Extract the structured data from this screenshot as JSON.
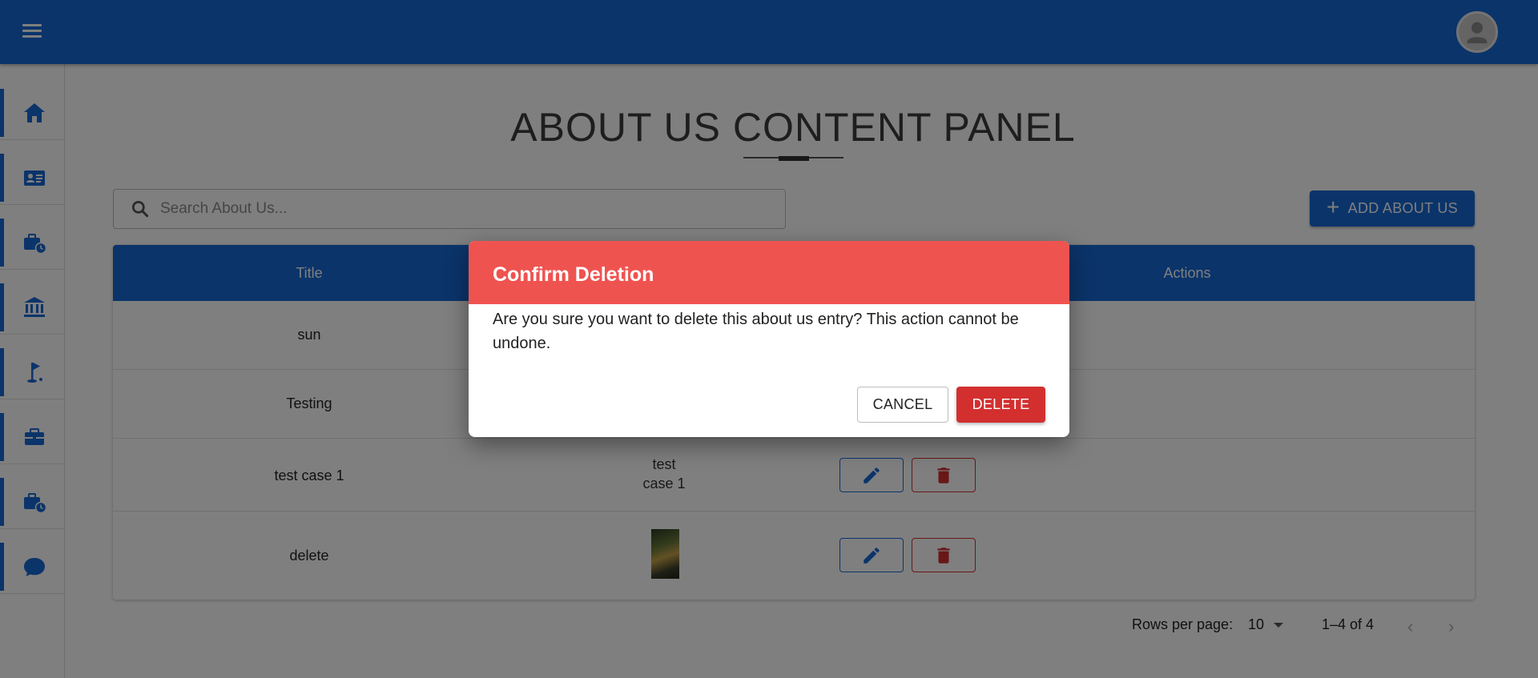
{
  "header": {
    "menu_icon": "hamburger-menu-icon",
    "avatar_icon": "user-avatar-icon"
  },
  "sidebar": {
    "items": [
      {
        "icon": "home-icon"
      },
      {
        "icon": "id-card-icon"
      },
      {
        "icon": "briefcase-clock-icon"
      },
      {
        "icon": "bank-icon"
      },
      {
        "icon": "golf-flag-icon"
      },
      {
        "icon": "briefcase-icon"
      },
      {
        "icon": "briefcase-clock-icon"
      },
      {
        "icon": "chat-bubble-icon"
      }
    ]
  },
  "main": {
    "title": "ABOUT US CONTENT PANEL",
    "search": {
      "placeholder": "Search About Us...",
      "value": ""
    },
    "add_button_label": "ADD ABOUT US"
  },
  "table": {
    "headers": {
      "title": "Title",
      "actions": "Actions"
    },
    "rows": [
      {
        "title": "sun"
      },
      {
        "title": "Testing"
      },
      {
        "title": "test case 1",
        "image_alt": "test case 1"
      },
      {
        "title": "delete",
        "image": "thumbnail"
      }
    ]
  },
  "pagination": {
    "rows_per_page_label": "Rows per page:",
    "rows_per_page_value": "10",
    "range": "1–4 of 4",
    "prev": "‹",
    "next": "›"
  },
  "dialog": {
    "title": "Confirm Deletion",
    "message": "Are you sure you want to delete this about us entry? This action cannot be undone.",
    "cancel_label": "CANCEL",
    "delete_label": "DELETE"
  },
  "colors": {
    "primary": "#1769d4",
    "danger": "#d32f2f",
    "dialog_header": "#ef5350"
  }
}
